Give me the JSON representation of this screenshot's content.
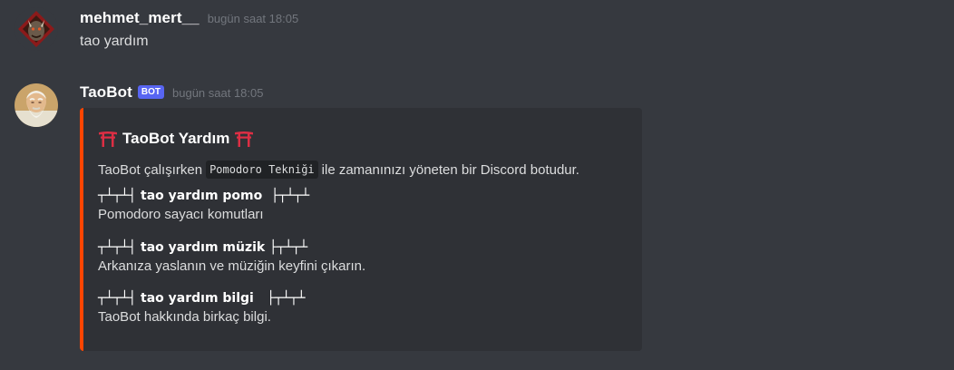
{
  "colors": {
    "background": "#36393f",
    "embed_background": "#2f3136",
    "embed_accent": "#ff4500",
    "bot_tag": "#5865f2",
    "timestamp": "#72767d"
  },
  "messages": [
    {
      "username": "mehmet_mert__",
      "timestamp": "bugün saat 18:05",
      "content": "tao yardım",
      "avatar_icon": "demon-avatar"
    },
    {
      "username": "TaoBot",
      "bot_tag": "BOT",
      "timestamp": "bugün saat 18:05",
      "avatar_icon": "old-sage-avatar",
      "embed": {
        "title": "TaoBot Yardım",
        "title_icon": "torii-gate-icon",
        "description_before": "TaoBot çalışırken",
        "description_code": "Pomodoro Tekniği",
        "description_after": "ile zamanınızı yöneten bir Discord botudur.",
        "fields": [
          {
            "name": "┬┴┬┴┤ tao yardım pomo  ├┬┴┬┴",
            "value": "Pomodoro sayacı komutları"
          },
          {
            "name": "┬┴┬┴┤ tao yardım müzik ├┬┴┬┴",
            "value": "Arkanıza yaslanın ve müziğin keyfini çıkarın."
          },
          {
            "name": "┬┴┬┴┤ tao yardım bilgi   ├┬┴┬┴",
            "value": "TaoBot hakkında birkaç bilgi."
          }
        ]
      }
    }
  ]
}
